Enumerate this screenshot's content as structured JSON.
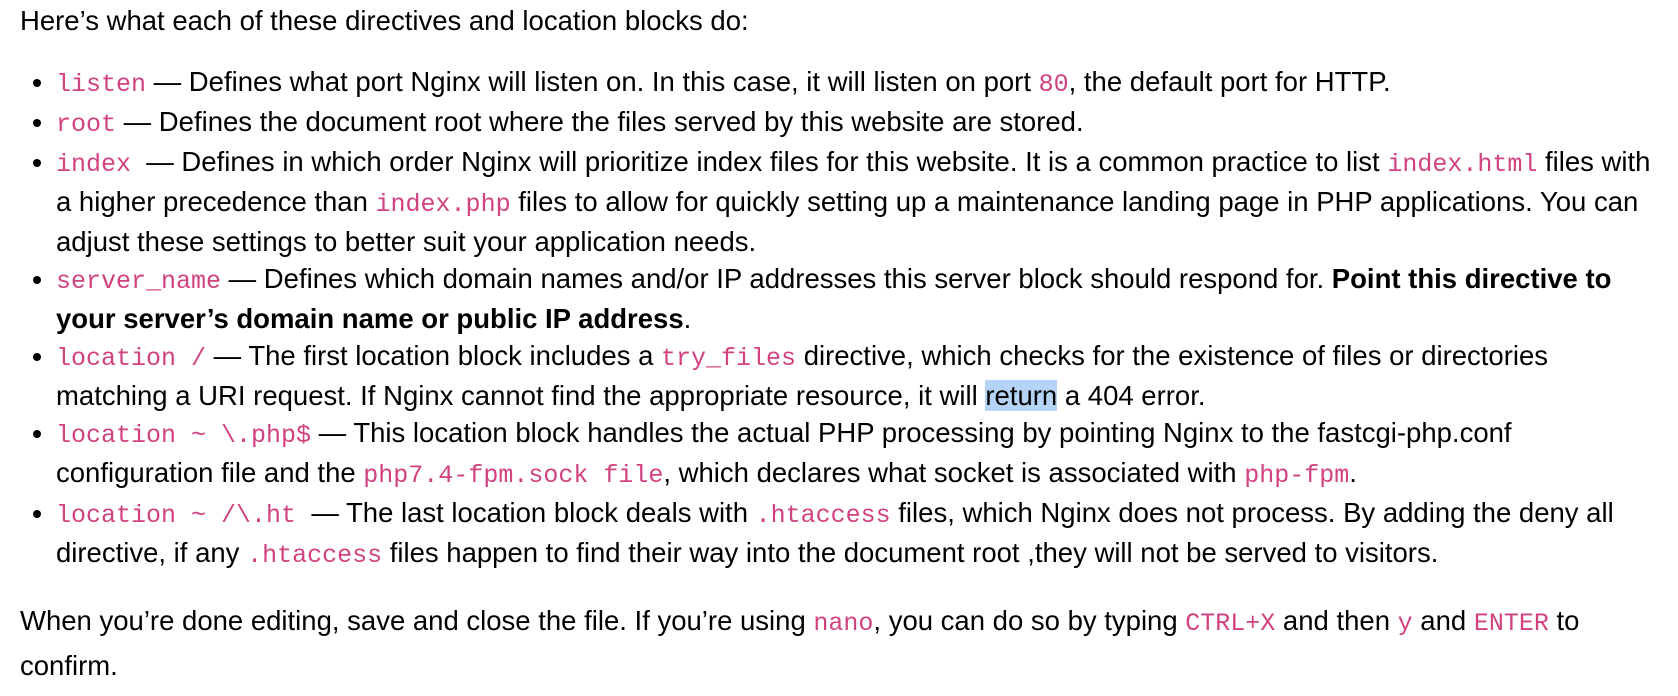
{
  "intro": "Here’s what each of these directives and location blocks do:",
  "accent_color": "#d1427f",
  "selection_color": "#b4d3f7",
  "items": [
    {
      "code": "listen",
      "t1": " — Defines what port Nginx will listen on. In this case, it will listen on port ",
      "c2": "80",
      "t2": ", the default port for HTTP."
    },
    {
      "code": "root",
      "t1": " — Defines the document root where the files served by this website are stored."
    },
    {
      "code": "index",
      "t1": "  — Defines in which order Nginx will prioritize index files for this website. It is a common practice to list ",
      "c2": "index.html",
      "t2": " files with a higher precedence than ",
      "c3": "index.php",
      "t3": " files to allow for quickly setting up a maintenance landing page in PHP applications. You can adjust these settings to better suit your application needs."
    },
    {
      "code": "server_name",
      "t1": " — Defines which domain names and/or IP addresses this server block should respond for. ",
      "bold": "Point this directive to your server’s domain name or public IP address",
      "t2": "."
    },
    {
      "code": "location /",
      "t1": " — The first location block includes a ",
      "c2": "try_files",
      "t2": " directive, which checks for the existence of files or directories matching a URI request. If Nginx cannot find the appropriate resource, it will ",
      "selected": "return",
      "t3": " a 404 error."
    },
    {
      "code": "location ~ \\.php$",
      "t1": " — This location block handles the actual PHP processing by pointing Nginx to the fastcgi-php.conf configuration file and the ",
      "c2": "php7.4-fpm.sock file",
      "t2": ", which declares what socket is associated with ",
      "c3": "php-fpm",
      "t3": "."
    },
    {
      "code": "location ~ /\\.ht",
      "t1": "  — The last location block deals with ",
      "c2": ".htaccess",
      "t2": " files, which Nginx does not process. By adding the deny all directive, if any ",
      "c3": ".htaccess",
      "t3": " files happen to find their way into the document root ,they will not be served to visitors."
    }
  ],
  "closing": {
    "t1": "When you’re done editing, save and close the file. If you’re using ",
    "c1": "nano",
    "t2": ", you can do so by typing ",
    "c2": "CTRL+X",
    "t3": " and then ",
    "c3": "y",
    "t4": " and ",
    "c4": "ENTER",
    "t5": " to confirm."
  }
}
